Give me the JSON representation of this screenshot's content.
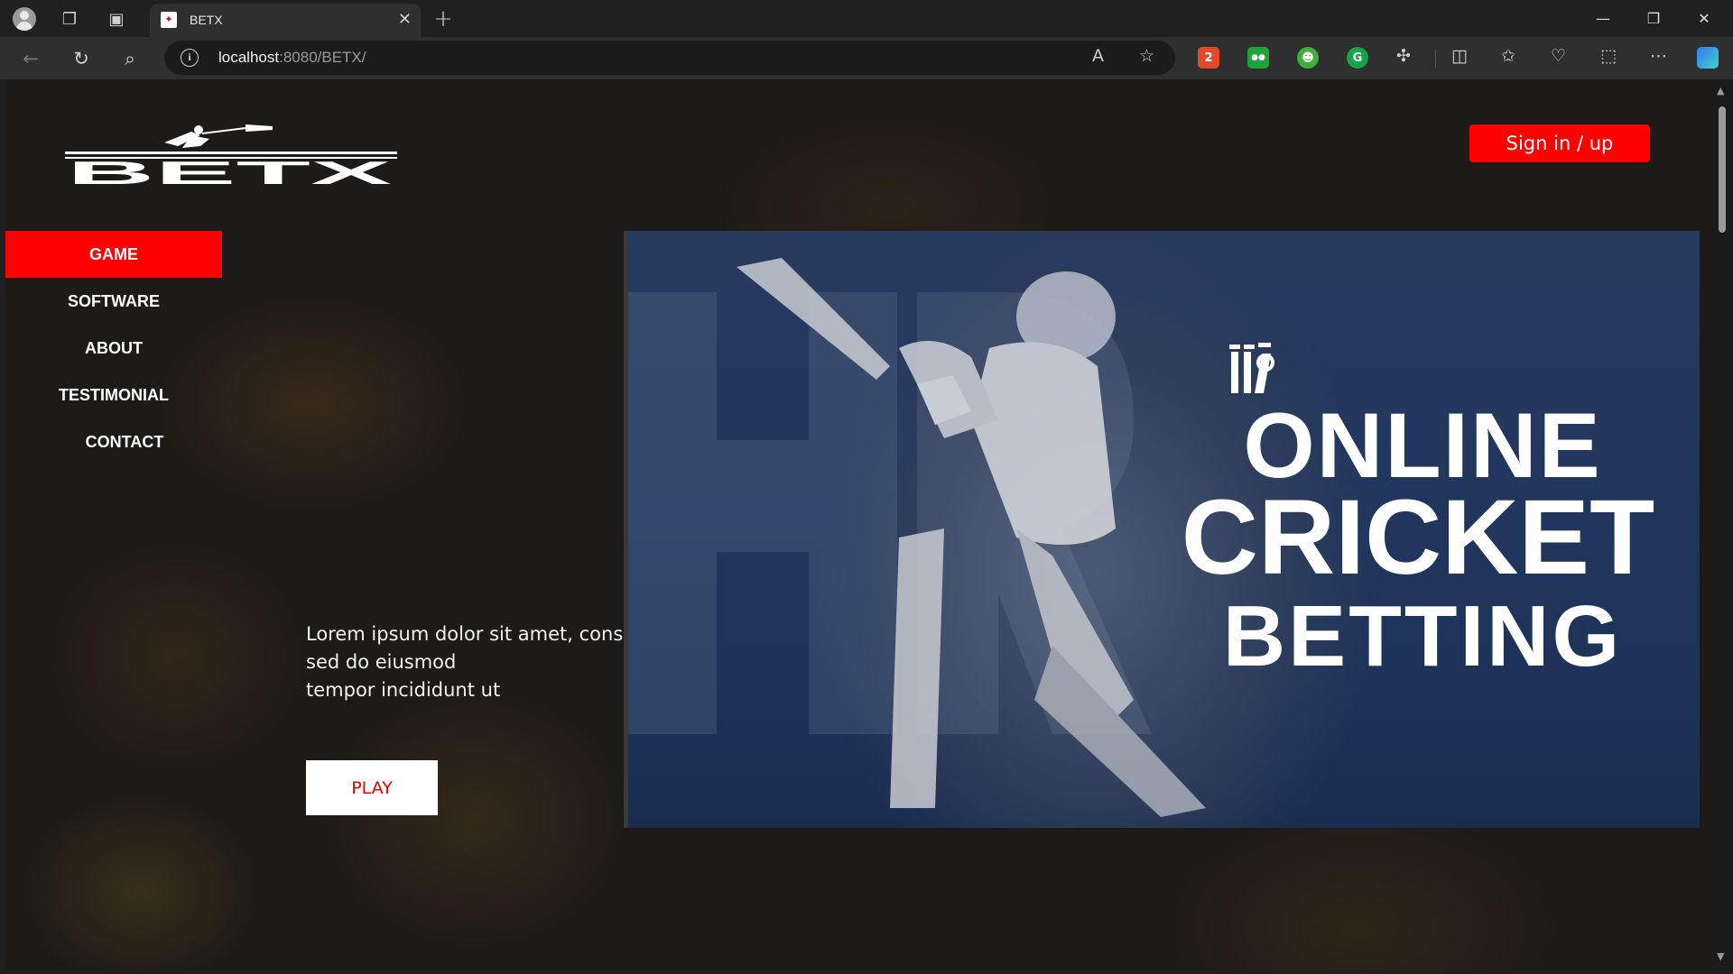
{
  "browser": {
    "tab_title": "BETX",
    "url_host": "localhost",
    "url_rest": ":8080/BETX/"
  },
  "header": {
    "logo_text": "BETX",
    "signin_label": "Sign in / up"
  },
  "sidenav": {
    "items": [
      {
        "label": "GAME"
      },
      {
        "label": "SOFTWARE"
      },
      {
        "label": "ABOUT"
      },
      {
        "label": "TESTIMONIAL"
      },
      {
        "label": "CONTACT"
      }
    ]
  },
  "hero": {
    "lines": [
      "Lorem ipsum dolor sit amet, cons",
      "sed do eiusmod",
      "tempor incididunt ut"
    ],
    "play_label": "PLAY"
  },
  "banner": {
    "line1": "ONLINE",
    "line2": "CRICKET",
    "line3": "BETTING"
  },
  "colors": {
    "accent": "#ff0000",
    "banner_blue": "#22375e"
  }
}
